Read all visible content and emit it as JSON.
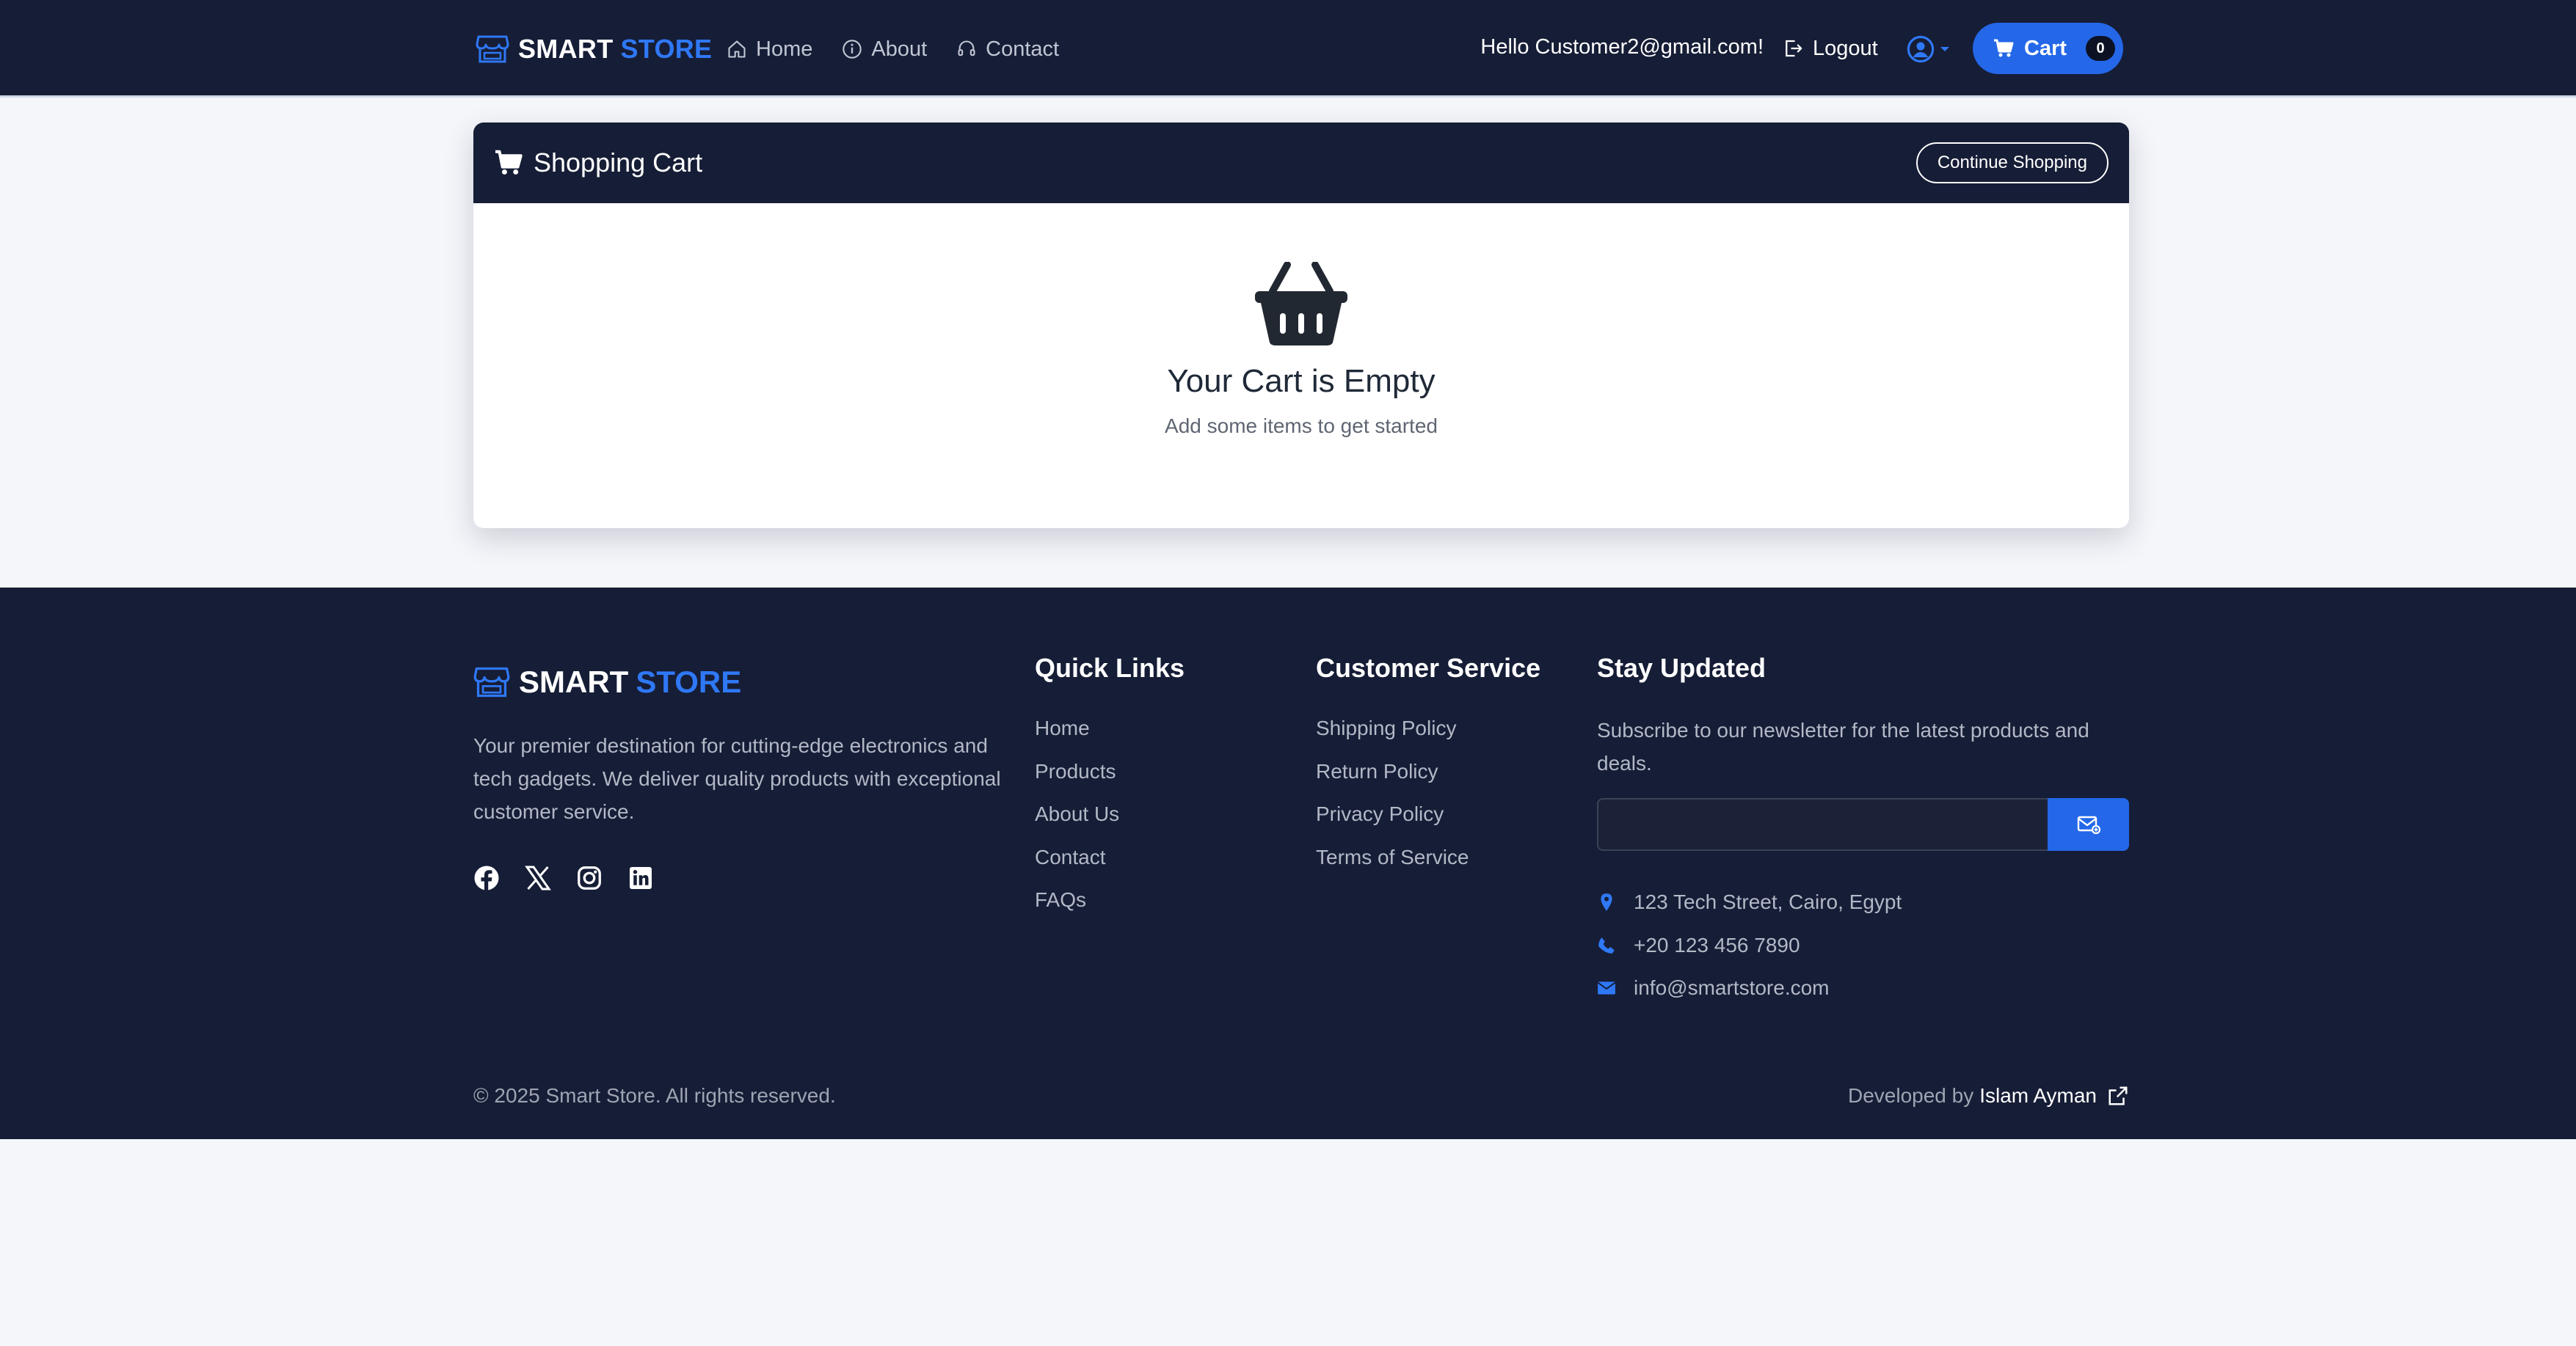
{
  "colors": {
    "navy": "#161d36",
    "accent_blue": "#2467e8",
    "brand_blue": "#2f78f6",
    "page_bg": "#f5f6fa"
  },
  "navbar": {
    "brand": {
      "part1": "SMART",
      "part2": "STORE",
      "icon": "store-icon"
    },
    "links": [
      {
        "label": "Home",
        "icon": "home-icon"
      },
      {
        "label": "About",
        "icon": "info-icon"
      },
      {
        "label": "Contact",
        "icon": "headset-icon"
      }
    ],
    "greeting": "Hello Customer2@gmail.com!",
    "logout_label": "Logout",
    "user_icon": "user-circle-icon",
    "cart": {
      "label": "Cart",
      "count": "0",
      "icon": "cart-icon"
    }
  },
  "cart_page": {
    "title": "Shopping Cart",
    "continue_label": "Continue Shopping",
    "empty_icon": "basket-icon",
    "empty_title": "Your Cart is Empty",
    "empty_subtitle": "Add some items to get started"
  },
  "footer": {
    "brand": {
      "part1": "SMART",
      "part2": "STORE"
    },
    "about": "Your premier destination for cutting-edge electronics and tech gadgets. We deliver quality products with exceptional customer service.",
    "socials": [
      "facebook-icon",
      "x-icon",
      "instagram-icon",
      "linkedin-icon"
    ],
    "quick_links": {
      "title": "Quick Links",
      "items": [
        "Home",
        "Products",
        "About Us",
        "Contact",
        "FAQs"
      ]
    },
    "customer_service": {
      "title": "Customer Service",
      "items": [
        "Shipping Policy",
        "Return Policy",
        "Privacy Policy",
        "Terms of Service"
      ]
    },
    "stay_updated": {
      "title": "Stay Updated",
      "text": "Subscribe to our newsletter for the latest products and deals.",
      "email_value": "",
      "subscribe_icon": "envelope-icon"
    },
    "contact": {
      "address": "123 Tech Street, Cairo, Egypt",
      "phone": "+20 123 456 7890",
      "email": "info@smartstore.com"
    },
    "copyright": "© 2025 Smart Store. All rights reserved.",
    "developed_by_label": "Developed by",
    "developer_name": "Islam Ayman"
  }
}
